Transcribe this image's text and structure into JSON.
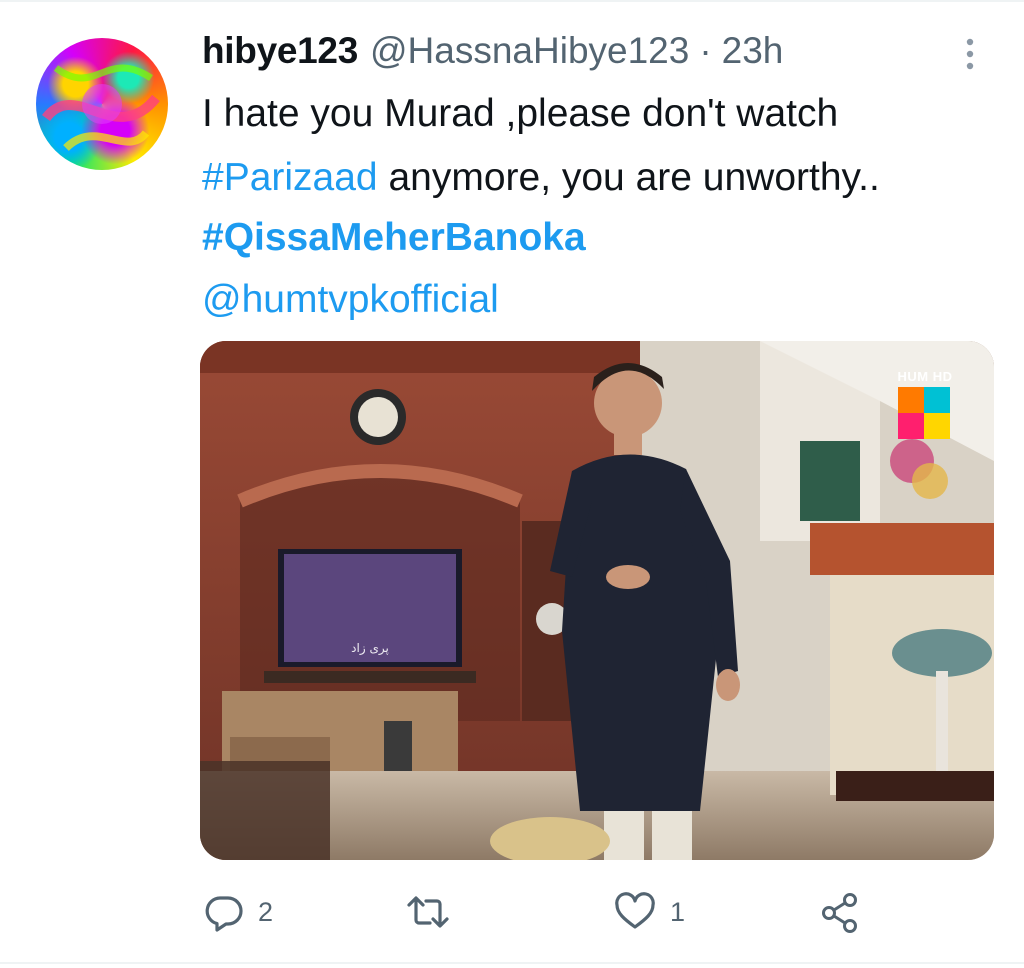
{
  "tweet": {
    "display_name": "hibye123",
    "handle": "@HassnaHibye123",
    "separator": "·",
    "time": "23h",
    "text_line1": "I hate you Murad ,please don't watch",
    "hashtag_parizaad": "#Parizaad",
    "text_line2_rest": " anymore, you are unworthy..",
    "hashtag_qissa": "#QissaMeherBanoka",
    "mention": "@humtvpkofficial"
  },
  "media": {
    "channel_logo_text": "HUM HD",
    "tv_screen_title": "پری زاد"
  },
  "actions": {
    "reply_count": "2",
    "retweet_count": "",
    "like_count": "1"
  },
  "icons": {
    "more": "more-vertical-icon",
    "reply": "reply-icon",
    "retweet": "retweet-icon",
    "like": "heart-icon",
    "share": "share-icon"
  },
  "colors": {
    "link": "#1d9bf0",
    "secondary_text": "#536471",
    "primary_text": "#0f1419"
  }
}
